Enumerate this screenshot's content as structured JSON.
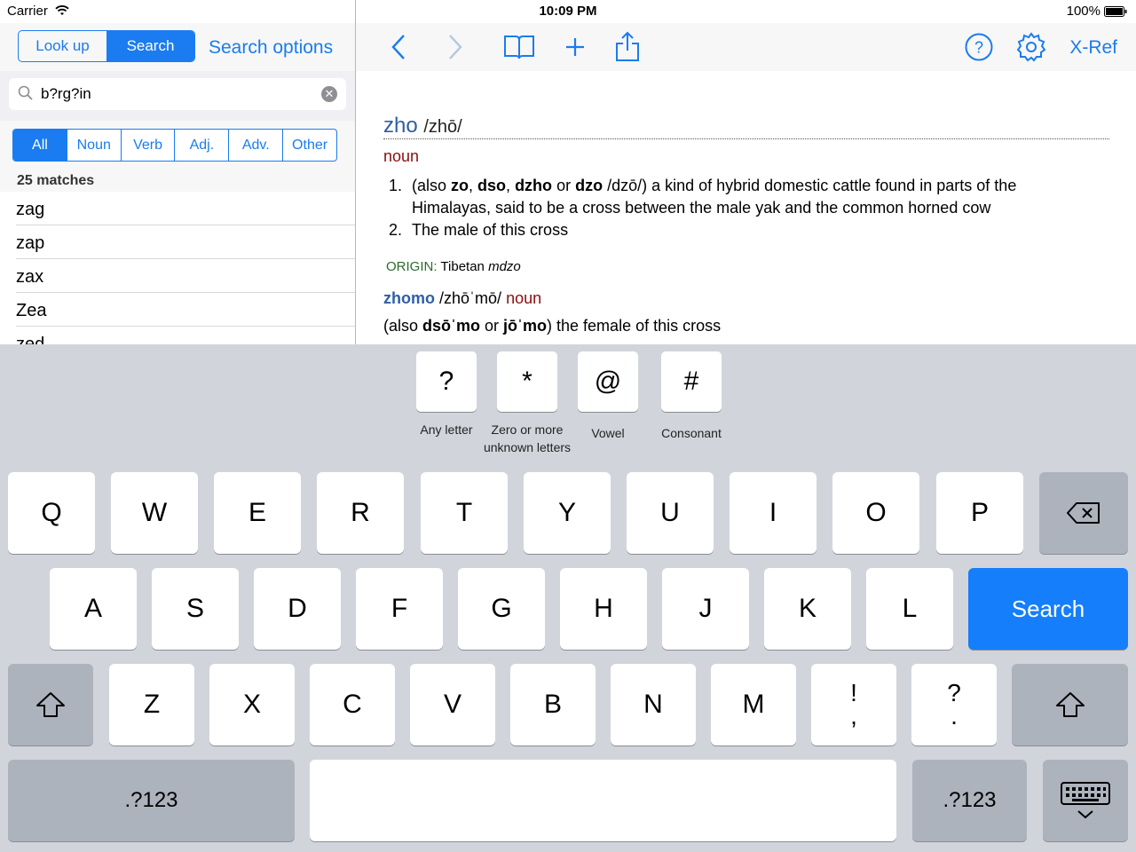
{
  "status": {
    "carrier": "Carrier",
    "time": "10:09 PM",
    "battery": "100%"
  },
  "left": {
    "mode_tabs": [
      "Look up",
      "Search"
    ],
    "search_options": "Search options",
    "query": "b?rg?in",
    "filters": [
      "All",
      "Noun",
      "Verb",
      "Adj.",
      "Adv.",
      "Other"
    ],
    "match_count": "25 matches",
    "results": [
      "zag",
      "zap",
      "zax",
      "Zea",
      "zed"
    ]
  },
  "toolbar": {
    "xref": "X-Ref"
  },
  "entry": {
    "headword": "zho",
    "pron": "/zhō/",
    "pos": "noun",
    "senses": [
      {
        "num": "1.",
        "text_parts": [
          "(also ",
          "zo",
          ", ",
          "dso",
          ", ",
          "dzho",
          " or ",
          "dzo",
          " /dzō/) a kind of hybrid domestic cattle found in parts of the"
        ],
        "line2": "Himalayas, said to be a cross between the male yak and the common horned cow"
      },
      {
        "num": "2.",
        "text": "The male of this cross"
      }
    ],
    "origin_label": "ORIGIN:",
    "origin_text": "Tibetan",
    "origin_italic": "mdzo",
    "sub_word": "zhomo",
    "sub_pron": "/zhōˈmō/",
    "sub_pos": "noun",
    "sub_def_parts": [
      "(also ",
      "dsōˈmo",
      " or ",
      "jōˈmo",
      ") the female of this cross"
    ]
  },
  "keyboard": {
    "tools": [
      {
        "sym": "?",
        "label": "Any letter"
      },
      {
        "sym": "*",
        "label": "Zero or more unknown letters"
      },
      {
        "sym": "@",
        "label": "Vowel"
      },
      {
        "sym": "#",
        "label": "Consonant"
      }
    ],
    "row1": [
      "Q",
      "W",
      "E",
      "R",
      "T",
      "Y",
      "U",
      "I",
      "O",
      "P"
    ],
    "row2": [
      "A",
      "S",
      "D",
      "F",
      "G",
      "H",
      "J",
      "K",
      "L"
    ],
    "row3": [
      "Z",
      "X",
      "C",
      "V",
      "B",
      "N",
      "M"
    ],
    "punct1": {
      "top": "!",
      "bottom": ","
    },
    "punct2": {
      "top": "?",
      "bottom": "."
    },
    "search": "Search",
    "numbers": ".?123",
    "icons": [
      "backspace-icon",
      "shift-icon",
      "keyboard-dismiss-icon"
    ]
  },
  "colors": {
    "accent": "#1a7cf0",
    "headword": "#2e5fa5",
    "pos": "#8b0e0e",
    "origin": "#2b6a2b",
    "search_key": "#147efb"
  }
}
